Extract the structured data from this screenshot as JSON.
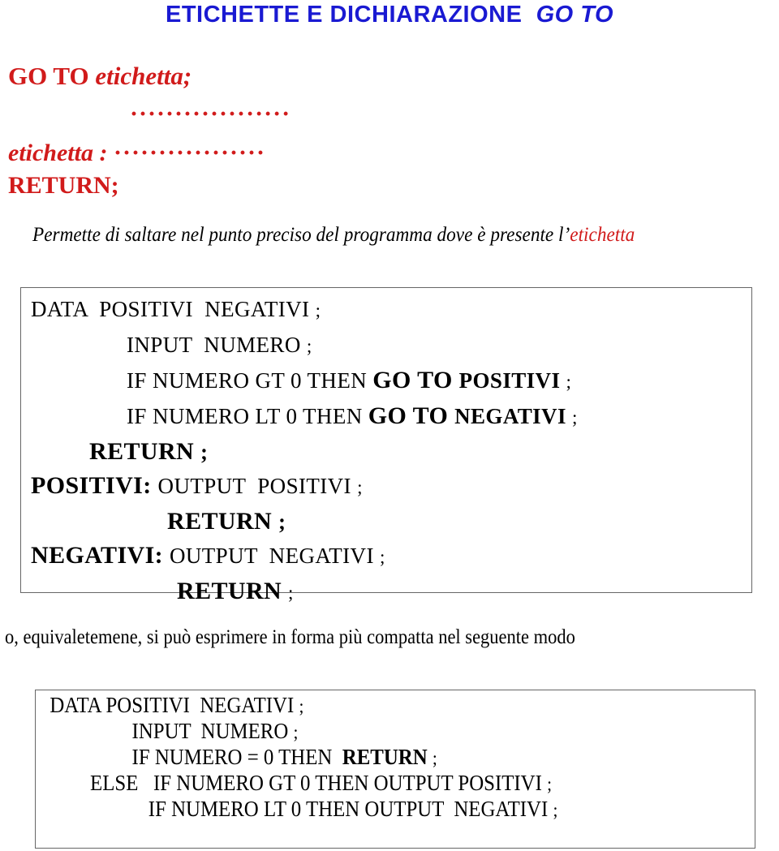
{
  "title": {
    "main": "ETICHETTE  E DICHIARAZIONE",
    "italic_part": "GO  TO"
  },
  "syntax": {
    "goto_keyword": "GO TO ",
    "goto_label": "etichetta;",
    "dots_line": "··················",
    "label_def": "etichetta : ",
    "label_dots": "·················",
    "return_line": "RETURN;"
  },
  "description": {
    "black_text": "Permette di saltare nel punto preciso del programma dove è presente l’",
    "red_text": "etichetta"
  },
  "code_block_1": {
    "lines": [
      {
        "indent": "ind1",
        "parts": [
          {
            "text": "DATA  POSITIVI  NEGATIVI ",
            "style": "normal"
          },
          {
            "text": ";",
            "style": "small"
          }
        ]
      },
      {
        "indent": "ind2",
        "parts": [
          {
            "text": "INPUT  NUMERO ",
            "style": "normal"
          },
          {
            "text": ";",
            "style": "small"
          }
        ]
      },
      {
        "indent": "ind3",
        "parts": [
          {
            "text": "IF NUMERO GT 0 THEN ",
            "style": "normal"
          },
          {
            "text": "GO TO ",
            "style": "bold-big"
          },
          {
            "text": "POSITIVI ",
            "style": "bold"
          },
          {
            "text": ";",
            "style": "small"
          }
        ]
      },
      {
        "indent": "ind3",
        "parts": [
          {
            "text": "IF NUMERO LT 0 THEN ",
            "style": "normal"
          },
          {
            "text": "GO TO ",
            "style": "bold-big"
          },
          {
            "text": "NEGATIVI ",
            "style": "bold"
          },
          {
            "text": ";",
            "style": "small"
          }
        ]
      },
      {
        "indent": "ind4",
        "parts": [
          {
            "text": "RETURN ",
            "style": "bold-big"
          },
          {
            "text": ";",
            "style": "bold"
          }
        ]
      },
      {
        "indent": "ind5",
        "parts": [
          {
            "text": "POSITIVI: ",
            "style": "bold-big"
          },
          {
            "text": "OUTPUT  POSITIVI ",
            "style": "normal"
          },
          {
            "text": ";",
            "style": "small"
          }
        ]
      },
      {
        "indent": "ind6",
        "parts": [
          {
            "text": "RETURN ",
            "style": "bold-big"
          },
          {
            "text": ";",
            "style": "bold"
          }
        ]
      },
      {
        "indent": "ind7",
        "parts": [
          {
            "text": "NEGATIVI: ",
            "style": "bold-big"
          },
          {
            "text": "OUTPUT  NEGATIVI ",
            "style": "normal"
          },
          {
            "text": ";",
            "style": "small"
          }
        ]
      },
      {
        "indent": "ind8",
        "parts": [
          {
            "text": "RETURN ",
            "style": "bold-big"
          },
          {
            "text": ";",
            "style": "small"
          }
        ]
      }
    ]
  },
  "mid_note": "o, equivaletemene, si può esprimere in forma più compatta nel seguente modo",
  "code_block_2": {
    "lines": [
      {
        "indent": "b2ind1",
        "parts": [
          {
            "text": "DATA POSITIVI  NEGATIVI ",
            "style": "normal"
          },
          {
            "text": ";",
            "style": "small"
          }
        ]
      },
      {
        "indent": "b2ind2",
        "parts": [
          {
            "text": "INPUT  NUMERO ",
            "style": "normal"
          },
          {
            "text": ";",
            "style": "small"
          }
        ]
      },
      {
        "indent": "b2ind3",
        "parts": [
          {
            "text": "IF NUMERO = 0 THEN  ",
            "style": "normal"
          },
          {
            "text": "RETURN ",
            "style": "bold"
          },
          {
            "text": ";",
            "style": "small"
          }
        ]
      },
      {
        "indent": "b2ind4",
        "parts": [
          {
            "text": "ELSE   IF NUMERO GT 0 THEN OUTPUT POSITIVI ",
            "style": "normal"
          },
          {
            "text": ";",
            "style": "small"
          }
        ]
      },
      {
        "indent": "b2ind5",
        "parts": [
          {
            "text": "IF NUMERO LT 0 THEN OUTPUT  NEGATIVI ",
            "style": "normal"
          },
          {
            "text": ";",
            "style": "small"
          }
        ]
      }
    ]
  },
  "colors": {
    "title_blue": "#1a1ad2",
    "accent_red": "#d11b1b",
    "box_border": "#666666",
    "text_black": "#000000"
  }
}
